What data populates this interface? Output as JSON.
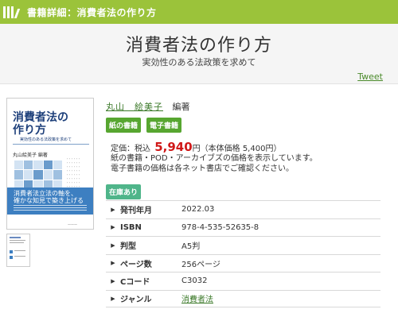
{
  "header": {
    "icon": "library-books-icon",
    "breadcrumb": "書籍詳細：消費者法の作り方",
    "color": "#9bc33a"
  },
  "book": {
    "title": "消費者法の作り方",
    "subtitle": "実効性のある法政策を求めて",
    "tweet_label": "Tweet",
    "author": "丸山　絵美子",
    "role": "編著",
    "formats": [
      "紙の書籍",
      "電子書籍"
    ],
    "price_label": "定価：税込",
    "price_amount": "5,940",
    "price_unit": "円",
    "price_note": "（本体価格 5,400円）",
    "note_line1": "紙の書籍・POD・アーカイブズの価格を表示しています。",
    "note_line2": "電子書籍の価格は各ネット書店でご確認ください。",
    "stock": "在庫あり"
  },
  "cover": {
    "title_line1": "消費者法の",
    "title_line2": "作り方",
    "subtitle": "実効性のある法政策を求めて",
    "author": "丸山絵美子 編著",
    "band_line1": "消費者法立法の軸を、",
    "band_line2": "確かな知見で築き上げる"
  },
  "details": [
    {
      "label": "発刊年月",
      "value": "2022.03",
      "link": false
    },
    {
      "label": "ISBN",
      "value": "978-4-535-52635-8",
      "link": false
    },
    {
      "label": "判型",
      "value": "A5判",
      "link": false
    },
    {
      "label": "ページ数",
      "value": "256ページ",
      "link": false
    },
    {
      "label": "Cコード",
      "value": "C3032",
      "link": false
    },
    {
      "label": "ジャンル",
      "value": "消費者法",
      "link": true
    }
  ]
}
